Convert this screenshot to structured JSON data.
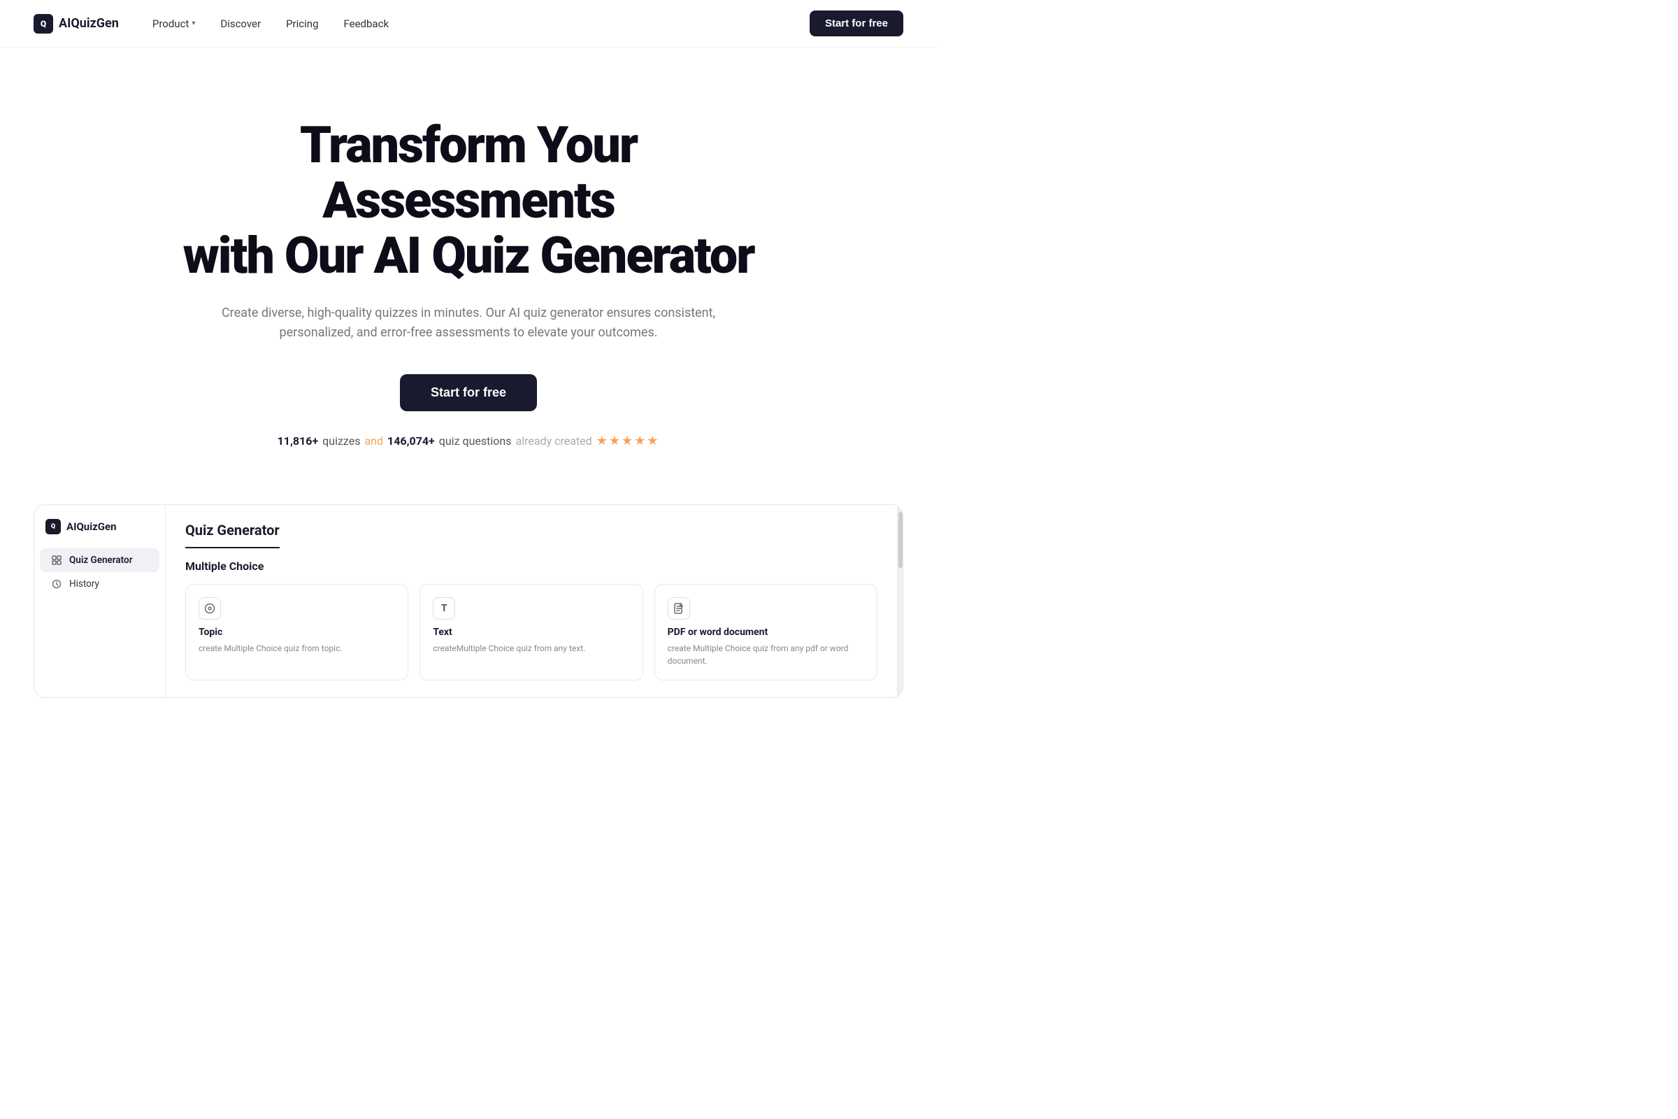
{
  "nav": {
    "logo_text": "AIQuizGen",
    "links": [
      {
        "label": "Product",
        "has_chevron": true
      },
      {
        "label": "Discover",
        "has_chevron": false
      },
      {
        "label": "Pricing",
        "has_chevron": false
      },
      {
        "label": "Feedback",
        "has_chevron": false
      }
    ],
    "cta_label": "Start for free"
  },
  "hero": {
    "title_line1": "Transform Your Assessments",
    "title_line2": "with Our AI Quiz Generator",
    "subtitle": "Create diverse, high-quality quizzes in minutes. Our AI quiz generator ensures consistent, personalized, and error-free assessments to elevate your outcomes.",
    "cta_label": "Start for free",
    "stats_quizzes": "11,816+",
    "stats_quizzes_suffix": "quizzes",
    "stats_and": "and",
    "stats_questions": "146,074+",
    "stats_questions_suffix": "quiz questions",
    "stats_already": "already created",
    "stars": "★★★★★"
  },
  "app_preview": {
    "sidebar": {
      "logo_text": "AIQuizGen",
      "items": [
        {
          "label": "Quiz Generator",
          "icon": "grid",
          "active": true
        },
        {
          "label": "History",
          "icon": "clock",
          "active": false
        }
      ]
    },
    "main": {
      "section_title": "Quiz Generator",
      "subsection_title": "Multiple Choice",
      "cards": [
        {
          "icon": "○",
          "title": "Topic",
          "description": "create Multiple Choice quiz from topic."
        },
        {
          "icon": "T",
          "title": "Text",
          "description": "createMultiple Choice quiz from any text."
        },
        {
          "icon": "📄",
          "title": "PDF or word document",
          "description": "create Multiple Choice quiz from any pdf or word document."
        }
      ]
    }
  }
}
